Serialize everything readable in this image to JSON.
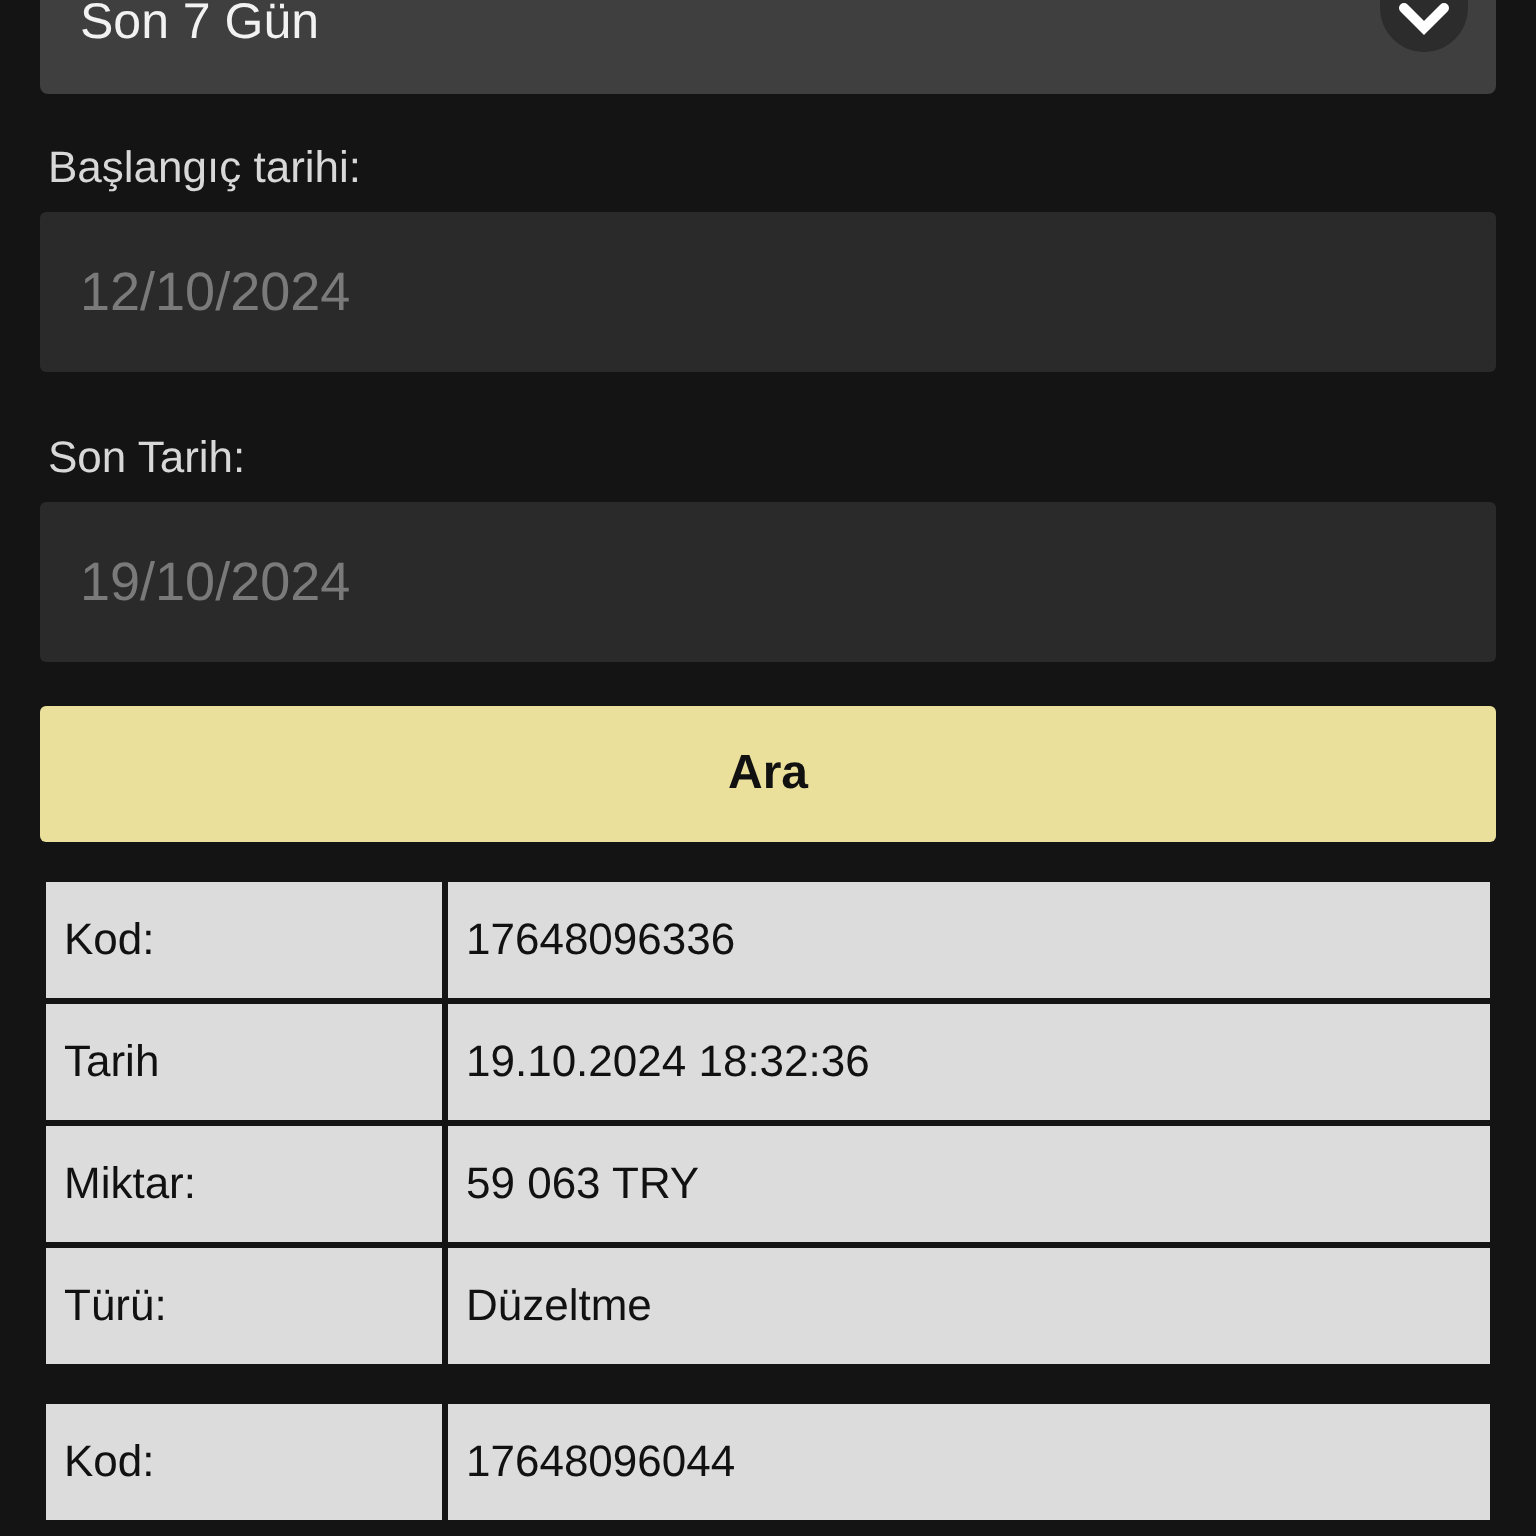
{
  "period_select": {
    "value": "Son 7 Gün"
  },
  "start_date": {
    "label": "Başlangıç tarihi:",
    "placeholder": "12/10/2024"
  },
  "end_date": {
    "label": "Son Tarih:",
    "placeholder": "19/10/2024"
  },
  "search_button": "Ara",
  "records": [
    {
      "rows": [
        {
          "label": "Kod:",
          "value": "17648096336"
        },
        {
          "label": "Tarih",
          "value": "19.10.2024 18:32:36"
        },
        {
          "label": "Miktar:",
          "value": "59 063 TRY"
        },
        {
          "label": "Türü:",
          "value": "Düzeltme"
        }
      ]
    },
    {
      "rows": [
        {
          "label": "Kod:",
          "value": "17648096044"
        }
      ]
    }
  ]
}
